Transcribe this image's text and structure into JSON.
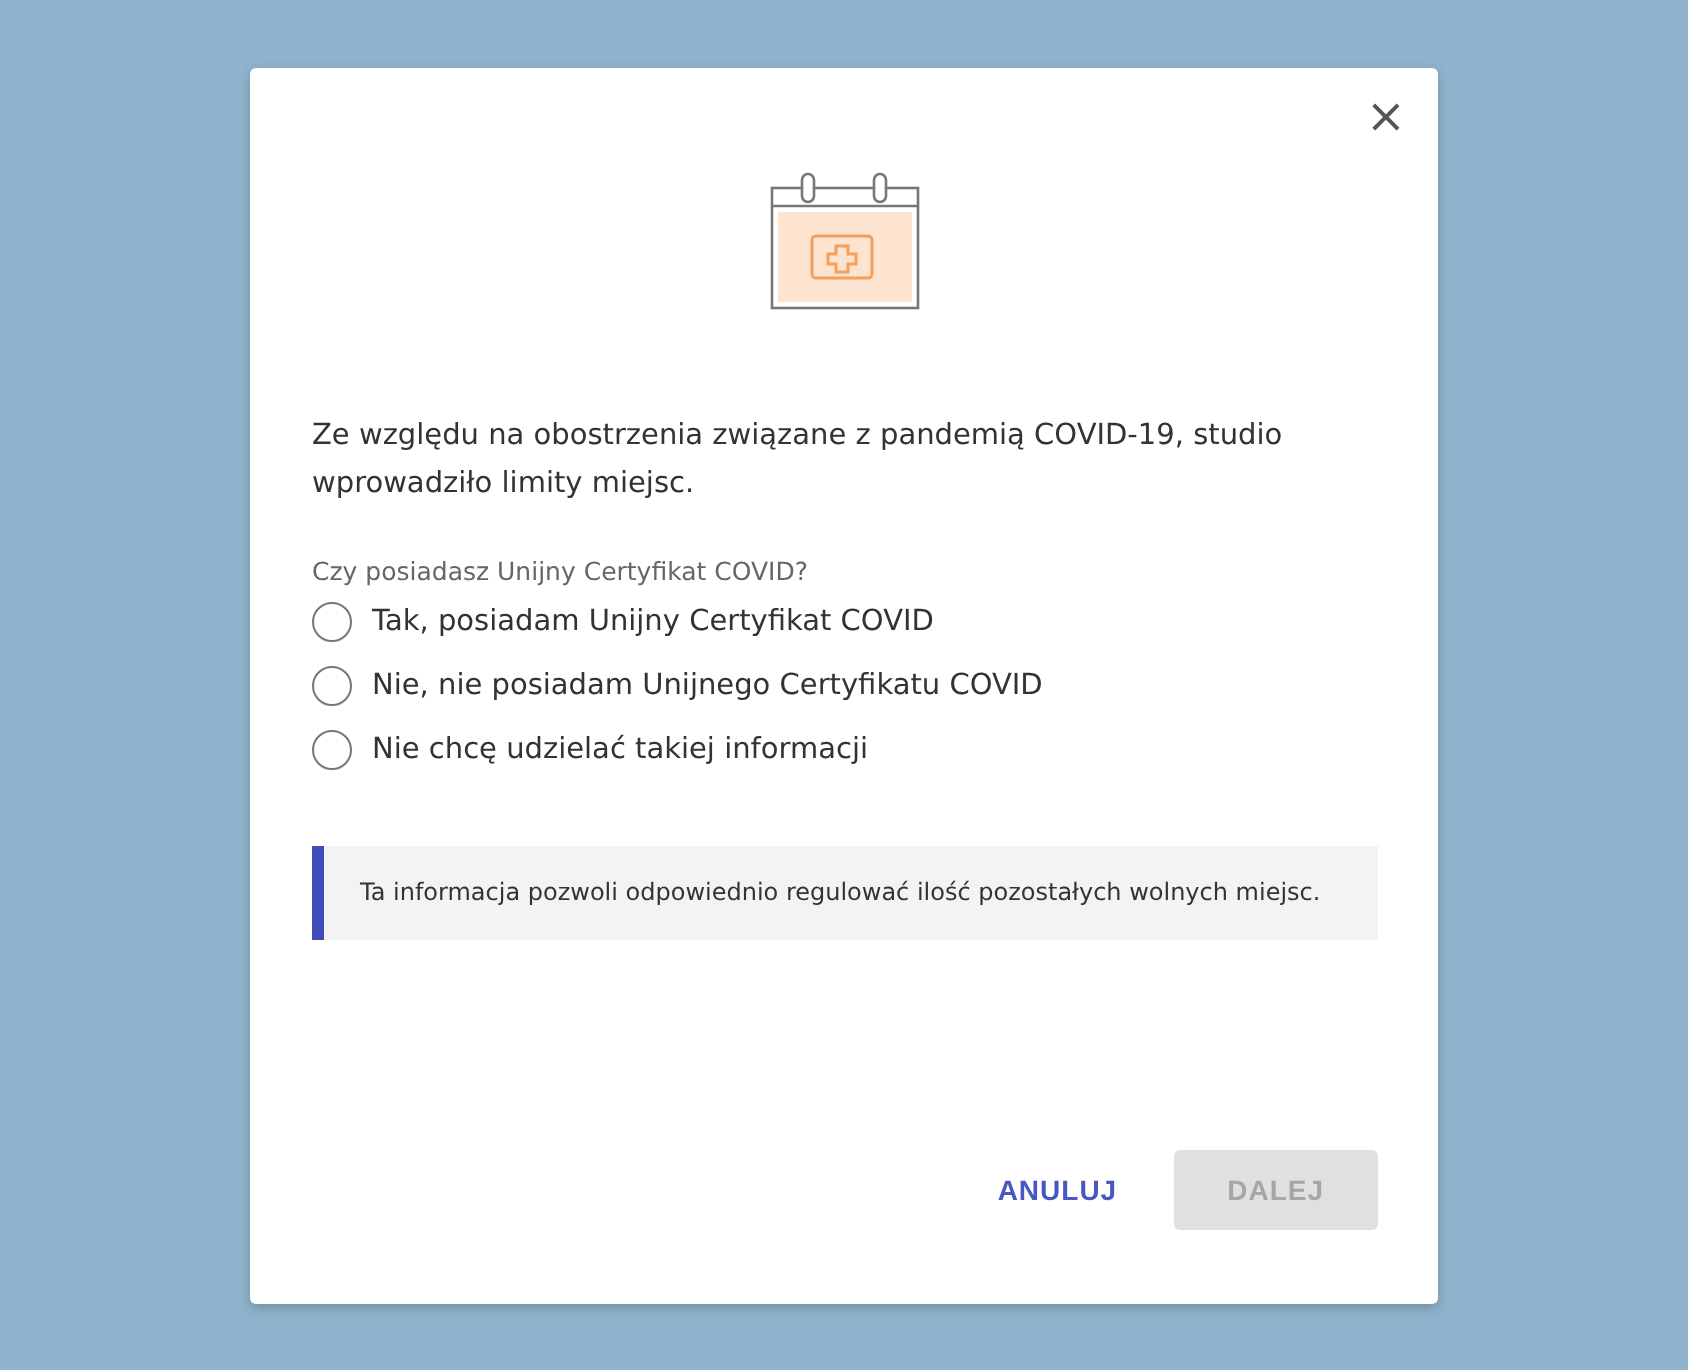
{
  "dialog": {
    "close": "×",
    "message": "Ze względu na obostrzenia związane z pandemią COVID-19, studio wprowadziło limity miejsc.",
    "question": "Czy posiadasz Unijny Certyfikat COVID?",
    "options": [
      {
        "label": "Tak, posiadam Unijny Certyfikat COVID",
        "selected": false
      },
      {
        "label": "Nie, nie posiadam Unijnego Certyfikatu COVID",
        "selected": false
      },
      {
        "label": "Nie chcę udzielać takiej informacji",
        "selected": false
      }
    ],
    "info": "Ta informacja pozwoli odpowiednio regulować ilość pozostałych wolnych miejsc.",
    "buttons": [
      {
        "label": "ANULUJ",
        "kind": "text",
        "disabled": false
      },
      {
        "label": "DALEJ",
        "kind": "filled",
        "disabled": true
      }
    ]
  }
}
